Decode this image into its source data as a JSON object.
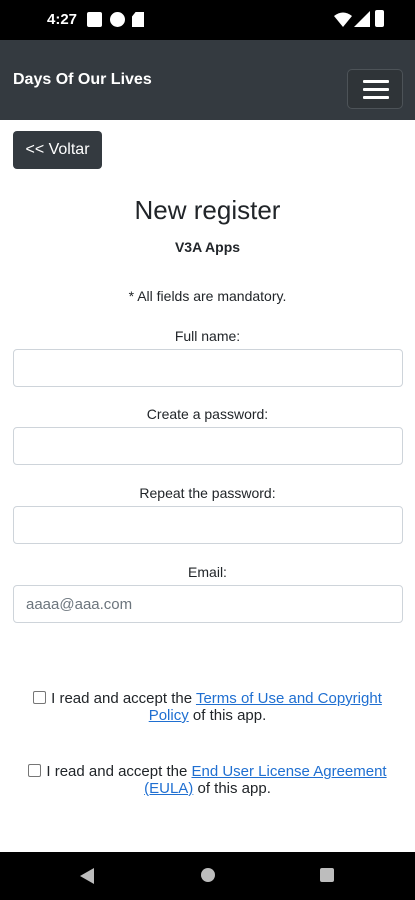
{
  "status_bar": {
    "time": "4:27",
    "icons": [
      "notification-square-icon",
      "app-circle-icon",
      "sd-card-icon",
      "wifi-icon",
      "signal-icon",
      "battery-icon"
    ]
  },
  "header": {
    "brand": "Days Of Our Lives",
    "menu_icon": "hamburger-menu-icon",
    "background": "#343a40"
  },
  "back_button": {
    "label": "<< Voltar"
  },
  "form": {
    "title": "New register",
    "subtitle": "V3A Apps",
    "note": "* All fields are mandatory.",
    "fields": [
      {
        "label": "Full name:",
        "value": "",
        "placeholder": ""
      },
      {
        "label": "Create a password:",
        "value": "",
        "placeholder": ""
      },
      {
        "label": "Repeat the password:",
        "value": "",
        "placeholder": ""
      },
      {
        "label": "Email:",
        "value": "",
        "placeholder": "aaaa@aaa.com"
      }
    ]
  },
  "terms": [
    {
      "checked": false,
      "prefix": "I read and accept the ",
      "link": "Terms of Use and Copyright Policy",
      "suffix": " of this app."
    },
    {
      "checked": false,
      "prefix": "I read and accept the ",
      "link": "End User License Agreement (EULA)",
      "suffix": " of this app."
    }
  ],
  "nav_bar": {
    "buttons": [
      "back-triangle-icon",
      "home-circle-icon",
      "recents-square-icon"
    ]
  },
  "colors": {
    "link": "#1f6fd1",
    "dark": "#343a40",
    "input_border": "#ced4da"
  }
}
